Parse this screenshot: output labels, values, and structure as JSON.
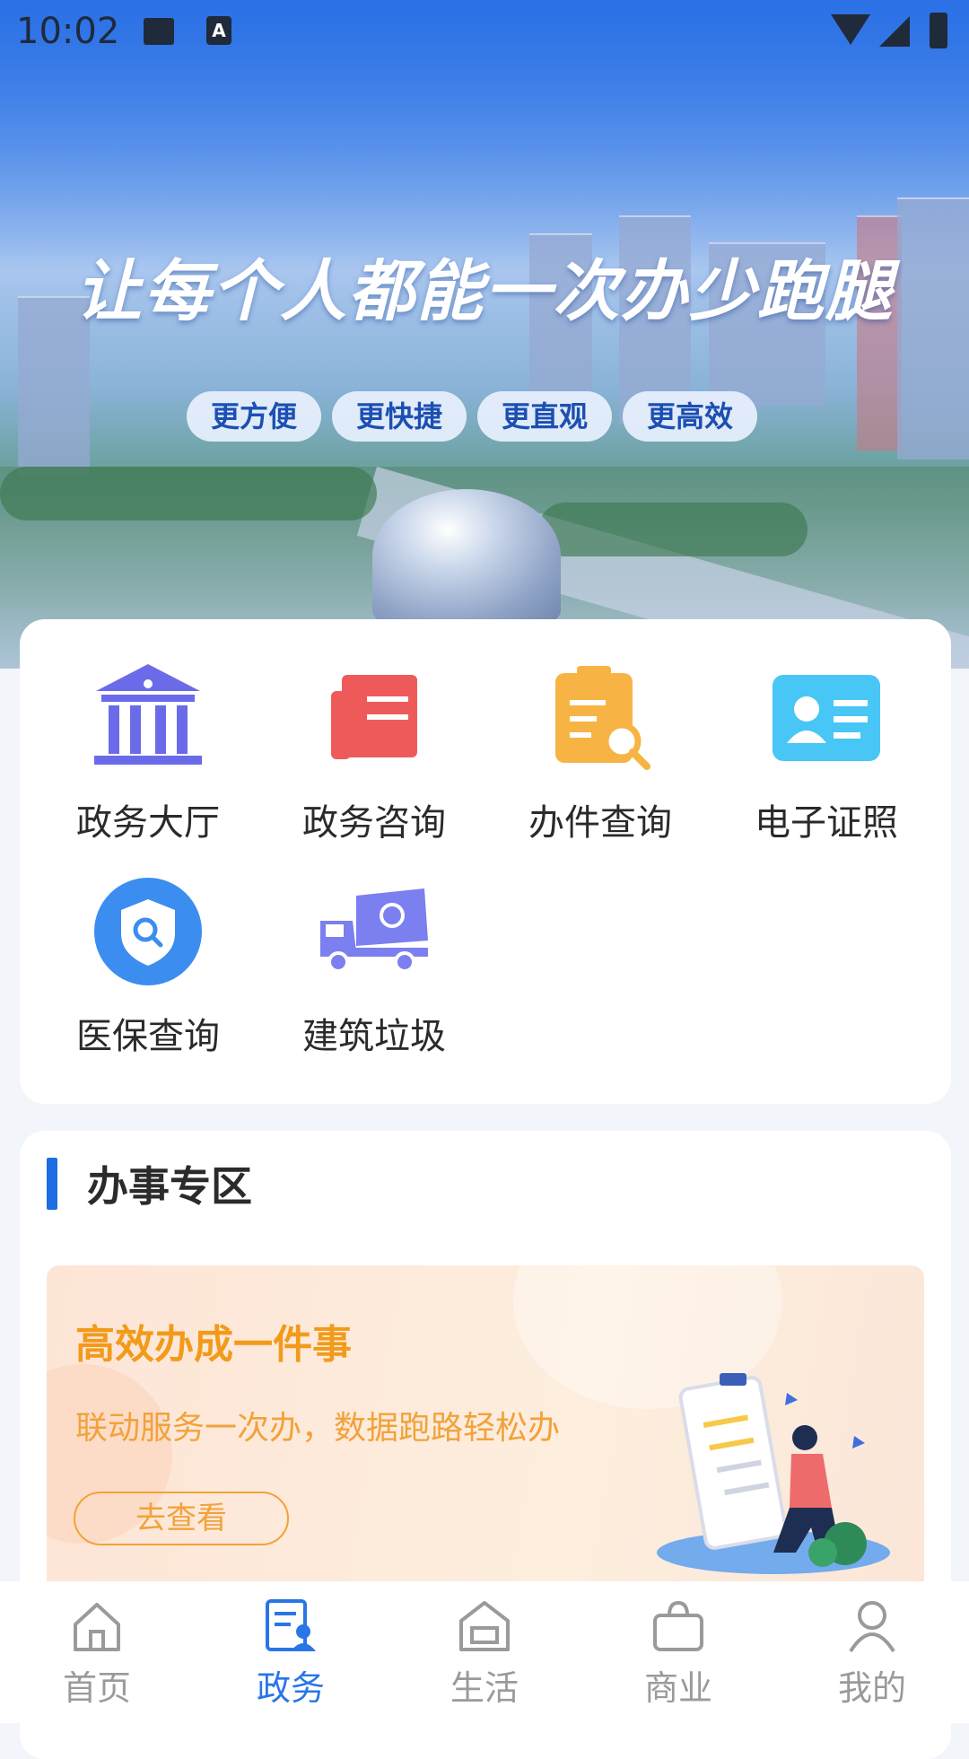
{
  "status_bar": {
    "time": "10:02"
  },
  "hero": {
    "slogan": "让每个人都能一次办少跑腿",
    "tags": [
      "更方便",
      "更快捷",
      "更直观",
      "更高效"
    ]
  },
  "services": [
    {
      "label": "政务大厅",
      "icon": "government-hall-icon",
      "color": "#6b6bea"
    },
    {
      "label": "政务咨询",
      "icon": "book-consult-icon",
      "color": "#ee5a5a"
    },
    {
      "label": "办件查询",
      "icon": "clipboard-search-icon",
      "color": "#f7b444"
    },
    {
      "label": "电子证照",
      "icon": "id-card-icon",
      "color": "#48c6f5"
    },
    {
      "label": "医保查询",
      "icon": "shield-search-icon",
      "color": "#3c8df0"
    },
    {
      "label": "建筑垃圾",
      "icon": "garbage-truck-icon",
      "color": "#7b7ff0"
    }
  ],
  "zone": {
    "title": "办事专区",
    "banner": {
      "heading": "高效办成一件事",
      "subtitle": "联动服务一次办，数据跑路轻松办",
      "button": "去查看"
    }
  },
  "tabbar": [
    {
      "label": "首页",
      "icon": "home-icon",
      "active": false
    },
    {
      "label": "政务",
      "icon": "government-doc-icon",
      "active": true
    },
    {
      "label": "生活",
      "icon": "life-icon",
      "active": false
    },
    {
      "label": "商业",
      "icon": "shopping-bag-icon",
      "active": false
    },
    {
      "label": "我的",
      "icon": "person-icon",
      "active": false
    }
  ],
  "colors": {
    "accent": "#2a76e6",
    "banner_text": "#f29a1a"
  }
}
